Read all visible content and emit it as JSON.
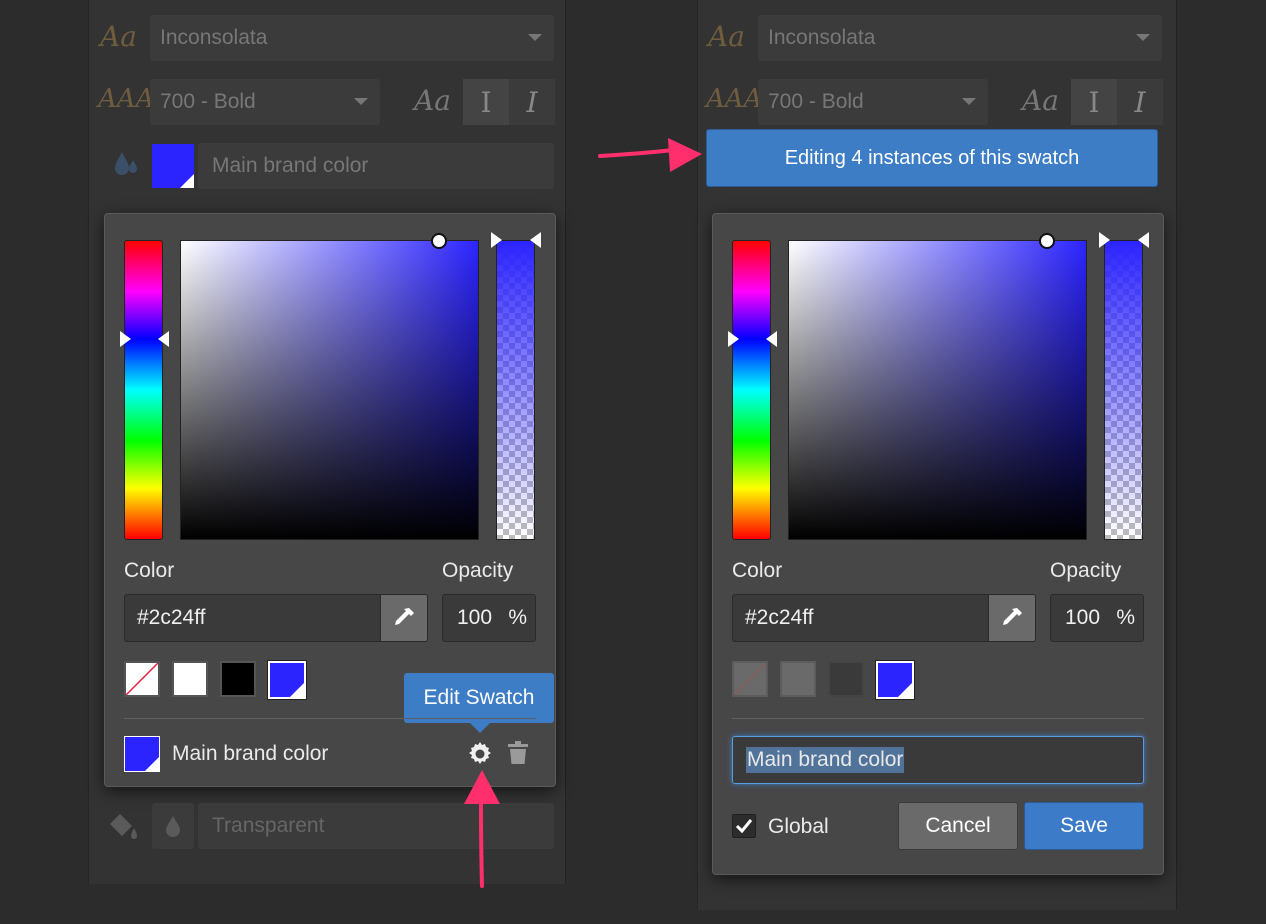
{
  "left": {
    "font_select": "Inconsolata",
    "weight_select": "700 - Bold",
    "swatch_name_field": "Main brand color",
    "picker": {
      "color_label": "Color",
      "opacity_label": "Opacity",
      "hex_value": "#2c24ff",
      "opacity_value": "100",
      "percent": "%",
      "swatch_name": "Main brand color"
    },
    "tooltip": "Edit Swatch",
    "fill_field": "Transparent"
  },
  "right": {
    "font_select": "Inconsolata",
    "weight_select": "700 - Bold",
    "banner": "Editing 4 instances of this swatch",
    "picker": {
      "color_label": "Color",
      "opacity_label": "Opacity",
      "hex_value": "#2c24ff",
      "opacity_value": "100",
      "percent": "%",
      "name_input": "Main brand color",
      "global_label": "Global",
      "global_checked": true,
      "cancel": "Cancel",
      "save": "Save"
    }
  },
  "colors": {
    "selected_color": "#2c24ff",
    "accent": "#3d7dc6",
    "arrow": "#ff2f6d"
  },
  "icons": [
    "font-family-icon",
    "font-weight-icon",
    "italic-style-icon",
    "text-color-icon",
    "eyedropper-icon",
    "gear-icon",
    "trash-icon",
    "paint-bucket-icon",
    "drop-icon",
    "checkbox-icon",
    "annotation-arrow"
  ]
}
